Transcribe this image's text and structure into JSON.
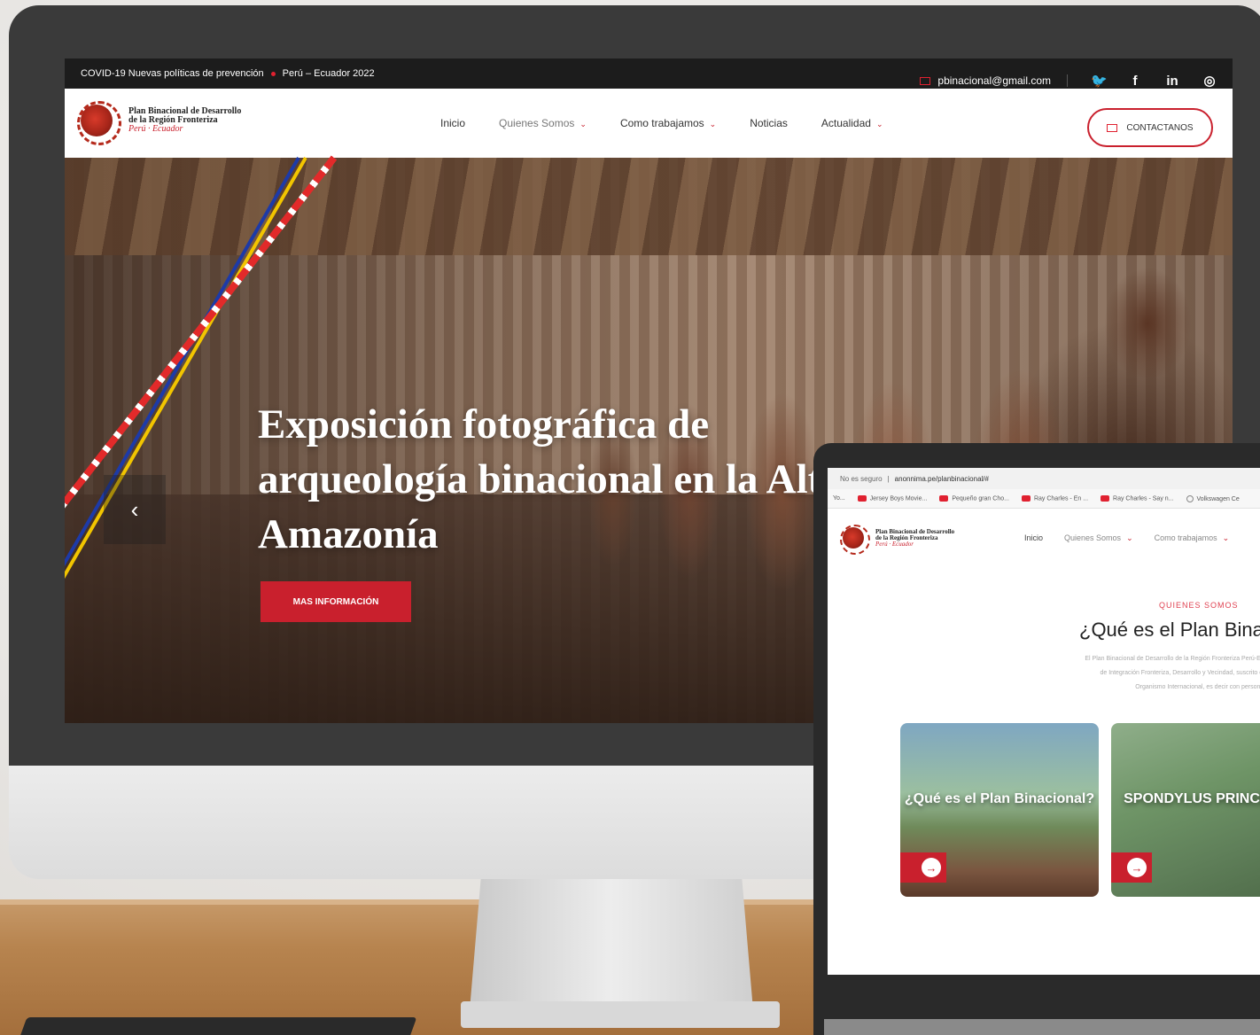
{
  "top_bar": {
    "notice": "COVID-19 Nuevas políticas de prevención",
    "region": "Perú – Ecuador 2022",
    "email": "pbinacional@gmail.com",
    "social_icons": [
      "twitter-icon",
      "facebook-icon",
      "linkedin-icon",
      "instagram-icon"
    ],
    "social_glyphs": [
      "🐦",
      "f",
      "in",
      "◎"
    ]
  },
  "logo": {
    "line1": "Plan Binacional de Desarrollo",
    "line2": "de la Región Fronteriza",
    "line3": "Perú · Ecuador"
  },
  "nav": {
    "items": [
      {
        "label": "Inicio",
        "has_dropdown": false
      },
      {
        "label": "Quienes Somos",
        "has_dropdown": true
      },
      {
        "label": "Como trabajamos",
        "has_dropdown": true
      },
      {
        "label": "Noticias",
        "has_dropdown": false
      },
      {
        "label": "Actualidad",
        "has_dropdown": true
      }
    ],
    "contact_label": "CONTACTANOS"
  },
  "hero": {
    "title": "Exposición fotográfica de arqueología binacional en la Alta Amazonía",
    "button_label": "MAS INFORMACIÓN",
    "prev_glyph": "‹"
  },
  "laptop": {
    "address_security": "No es seguro",
    "address_url": "anonnima.pe/planbinacional/#",
    "bookmarks": [
      "Yo...",
      "Jersey Boys Movie...",
      "Pequeño gran Cho...",
      "Ray Charles - En ...",
      "Ray Charles - Say n...",
      "Volkswagen Ce"
    ],
    "nav_items": [
      "Inicio",
      "Quienes Somos",
      "Como trabajamos"
    ],
    "kicker": "QUIENES SOMOS",
    "heading": "¿Qué es el Plan Bina",
    "paragraph_lines": [
      "El Plan Binacional de Desarrollo de la Región Fronteriza Perú-Ecuad",
      "de Integración Fronteriza, Desarrollo y Vecindad, suscrito en Br",
      "Organismo Internacional, es decir con personería j"
    ],
    "cards": [
      {
        "title": "¿Qué es el Plan Binacional?"
      },
      {
        "title": "SPONDYLUS PRINCEPS"
      }
    ]
  },
  "colors": {
    "brand_red": "#c9202d",
    "topbar_bg": "#1c1c1c"
  }
}
